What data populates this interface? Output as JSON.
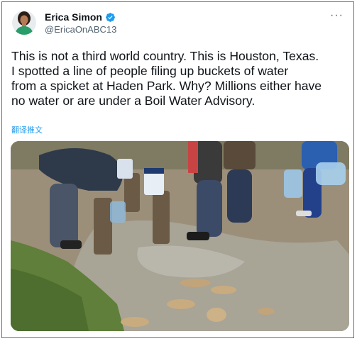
{
  "author": {
    "display_name": "Erica Simon",
    "handle": "@EricaOnABC13",
    "verified_icon": "verified-badge-icon"
  },
  "more_icon": "more-options-icon",
  "tweet": {
    "lines": [
      "This is not a third world country. This is Houston, Texas.",
      "I spotted a line of people filing up buckets of water",
      "from a spicket at Haden Park. Why? Millions either have",
      "no water or are under a Boil Water Advisory."
    ],
    "translate_label": "翻译推文"
  },
  "colors": {
    "text": "#0f1419",
    "secondary": "#536471",
    "link": "#1d9bf0",
    "verified": "#1d9bf0"
  }
}
